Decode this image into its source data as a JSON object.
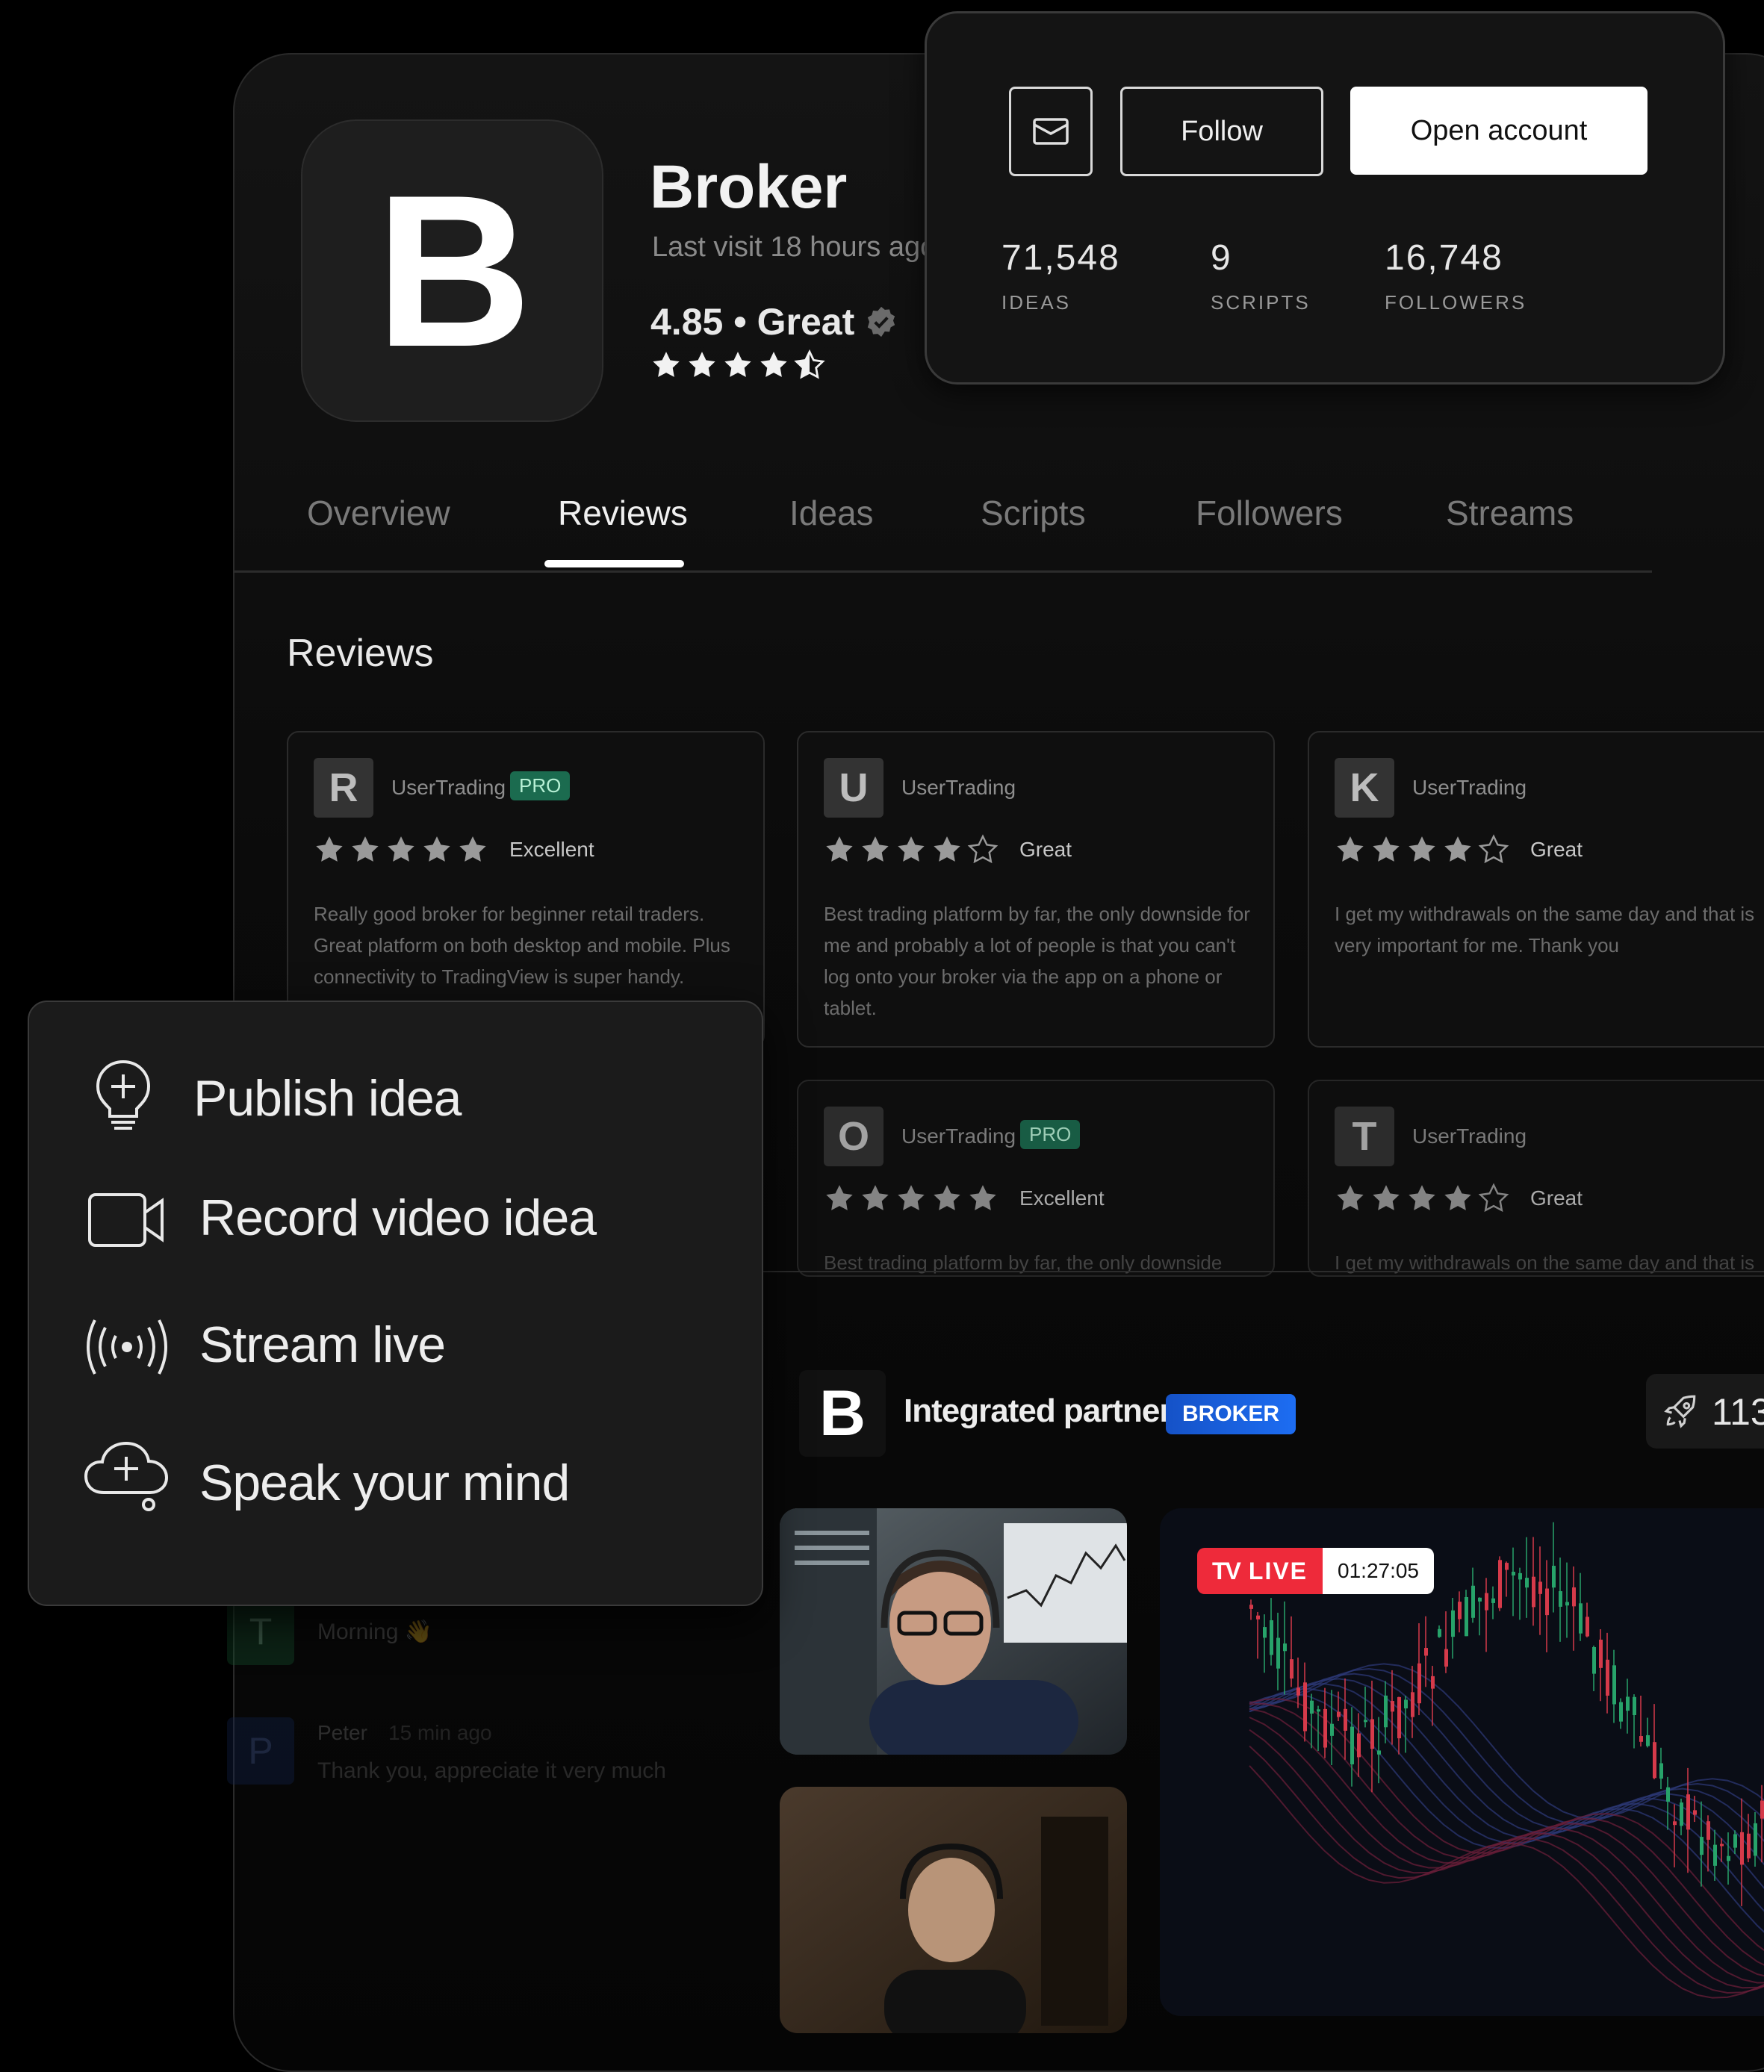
{
  "broker": {
    "logo_letter": "B",
    "name": "Broker",
    "last_visit": "Last visit 18 hours ago",
    "rating": "4.85 • Great",
    "stars": 4.5
  },
  "profile": {
    "follow_label": "Follow",
    "open_account_label": "Open account",
    "stats": [
      {
        "value": "71,548",
        "label": "IDEAS"
      },
      {
        "value": "9",
        "label": "SCRIPTS"
      },
      {
        "value": "16,748",
        "label": "FOLLOWERS"
      }
    ]
  },
  "tabs": [
    "Overview",
    "Reviews",
    "Ideas",
    "Scripts",
    "Followers",
    "Streams"
  ],
  "active_tab": "Reviews",
  "reviews_heading": "Reviews",
  "reviews": [
    {
      "initial": "R",
      "user": "UserTrading",
      "badge": "PRO",
      "stars": 5,
      "label": "Excellent",
      "text": "Really good broker for beginner retail traders. Great platform on both desktop and mobile. Plus connectivity to TradingView is super handy."
    },
    {
      "initial": "U",
      "user": "UserTrading",
      "badge": "",
      "stars": 4,
      "label": "Great",
      "text": "Best trading platform by far, the only downside for me and probably a lot of people is that you can't log onto your broker via the app on a phone or tablet."
    },
    {
      "initial": "K",
      "user": "UserTrading",
      "badge": "",
      "stars": 4,
      "label": "Great",
      "text": "I get my withdrawals on the same day and that is very important for me. Thank you"
    },
    {
      "initial": "O",
      "user": "UserTrading",
      "badge": "PRO",
      "stars": 5,
      "label": "Excellent",
      "text": "Best trading platform by far, the only downside"
    },
    {
      "initial": "T",
      "user": "UserTrading",
      "badge": "",
      "stars": 4,
      "label": "Great",
      "text": "I get my withdrawals on the same day and that is"
    }
  ],
  "menu": {
    "items": [
      {
        "label": "Publish idea",
        "icon": "lightbulb-plus-icon"
      },
      {
        "label": "Record video idea",
        "icon": "video-camera-icon"
      },
      {
        "label": "Stream live",
        "icon": "broadcast-icon"
      },
      {
        "label": "Speak your mind",
        "icon": "cloud-plus-icon"
      }
    ]
  },
  "partner": {
    "logo_letter": "B",
    "title": "Integrated partner",
    "badge": "BROKER",
    "boost_count": "113"
  },
  "stream": {
    "live_label": "LIVE",
    "duration": "01:27:05",
    "live_logo": "TV"
  },
  "chat": {
    "messages": [
      {
        "initial": "T",
        "text": "Morning 👋"
      },
      {
        "initial": "P",
        "name": "Peter",
        "time": "15 min ago",
        "text": "Thank you, appreciate it very much"
      }
    ]
  },
  "colors": {
    "pro_badge": "#1b6b4f",
    "broker_badge": "#1d6df2",
    "live_red": "#ee2a3a"
  }
}
